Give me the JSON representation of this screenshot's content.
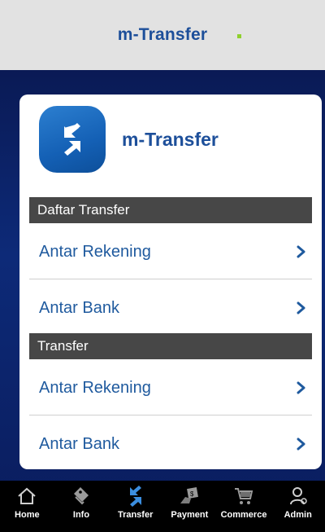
{
  "header": {
    "title": "m-Transfer",
    "dot_color": "#8fd02e"
  },
  "card": {
    "title": "m-Transfer",
    "icon": "transfer-arrows-icon"
  },
  "sections": [
    {
      "title": "Daftar Transfer",
      "items": [
        {
          "label": "Antar Rekening"
        },
        {
          "label": "Antar Bank"
        }
      ]
    },
    {
      "title": "Transfer",
      "items": [
        {
          "label": "Antar Rekening"
        },
        {
          "label": "Antar Bank"
        }
      ]
    }
  ],
  "bottom_nav": [
    {
      "label": "Home",
      "icon": "home-icon"
    },
    {
      "label": "Info",
      "icon": "info-tag-icon"
    },
    {
      "label": "Transfer",
      "icon": "transfer-icon",
      "active": true
    },
    {
      "label": "Payment",
      "icon": "payment-icon"
    },
    {
      "label": "Commerce",
      "icon": "cart-icon"
    },
    {
      "label": "Admin",
      "icon": "admin-icon"
    }
  ],
  "colors": {
    "accent": "#1d4f9a",
    "section_bg": "#474747",
    "background": "#0d2a78"
  }
}
